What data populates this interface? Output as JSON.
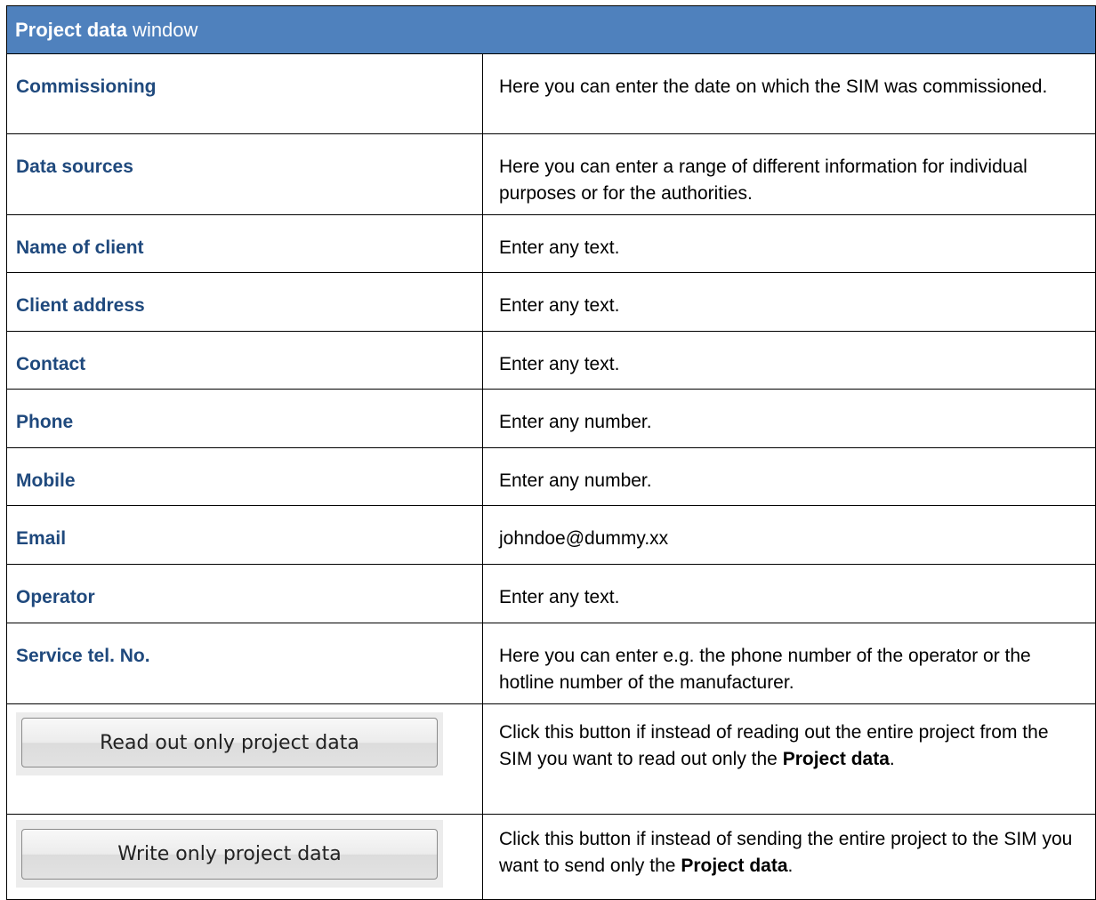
{
  "title": {
    "bold": "Project data",
    "rest": " window"
  },
  "rows": [
    {
      "term": "Commissioning",
      "desc": "Here you can enter the date on which the SIM was commissioned."
    },
    {
      "term": "Data sources",
      "desc": "Here you can enter a range of different information for individual purposes or for the authorities."
    },
    {
      "term": "Name of client",
      "desc": "Enter any text."
    },
    {
      "term": "Client address",
      "desc": "Enter any text."
    },
    {
      "term": "Contact",
      "desc": "Enter any text."
    },
    {
      "term": "Phone",
      "desc": "Enter any number."
    },
    {
      "term": "Mobile",
      "desc": "Enter any number."
    },
    {
      "term": "Email",
      "desc": "johndoe@dummy.xx"
    },
    {
      "term": "Operator",
      "desc": "Enter any text."
    },
    {
      "term": "Service tel. No.",
      "desc": "Here you can enter e.g. the phone number of the operator or the hotline number of the manufacturer."
    }
  ],
  "buttons": [
    {
      "label": "Read out only project data",
      "desc_before": "Click this button if instead of reading out the entire project from the SIM you want to read out only the ",
      "desc_bold": "Project data",
      "desc_after": "."
    },
    {
      "label": "Write only project data",
      "desc_before": "Click this button if instead of sending the entire project to the SIM you want to send only the ",
      "desc_bold": "Project data",
      "desc_after": "."
    }
  ]
}
